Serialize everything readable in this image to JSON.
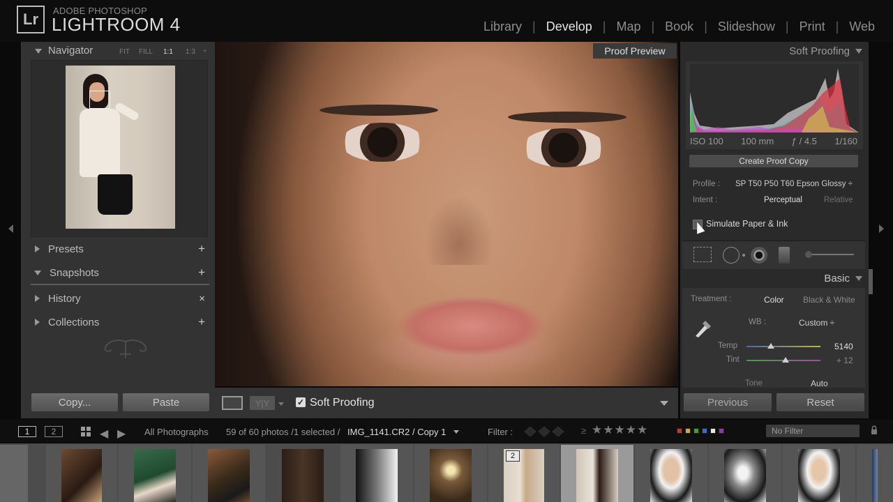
{
  "app": {
    "logo": "Lr",
    "brand_line1": "ADOBE PHOTOSHOP",
    "brand_line2": "LIGHTROOM 4"
  },
  "modules": [
    {
      "label": "Library",
      "active": false
    },
    {
      "label": "Develop",
      "active": true
    },
    {
      "label": "Map",
      "active": false
    },
    {
      "label": "Book",
      "active": false
    },
    {
      "label": "Slideshow",
      "active": false
    },
    {
      "label": "Print",
      "active": false
    },
    {
      "label": "Web",
      "active": false
    }
  ],
  "navigator": {
    "title": "Navigator",
    "zoom_options": [
      "FIT",
      "FILL",
      "1:1",
      "1:3"
    ],
    "active_zoom": "1:1"
  },
  "left_panels": [
    {
      "title": "Presets",
      "action": "+"
    },
    {
      "title": "Snapshots",
      "action": "+"
    },
    {
      "title": "History",
      "action": "×"
    },
    {
      "title": "Collections",
      "action": "+"
    }
  ],
  "left_buttons": {
    "copy": "Copy...",
    "paste": "Paste"
  },
  "center": {
    "proof_label": "Proof Preview"
  },
  "toolbar": {
    "view_compare": "Y|Y",
    "soft_proofing_label": "Soft Proofing",
    "soft_proofing_checked": true
  },
  "soft_proofing": {
    "title": "Soft Proofing",
    "histogram_meta": [
      "ISO 100",
      "100 mm",
      "ƒ / 4.5",
      "1/160"
    ],
    "create_proof_copy": "Create Proof Copy",
    "profile_label": "Profile :",
    "profile_value": "SP T50 P50 T60 Epson Glossy ÷",
    "intent_label": "Intent :",
    "intent_options": [
      "Perceptual",
      "Relative"
    ],
    "intent_selected": "Perceptual",
    "simulate_label": "Simulate Paper & Ink",
    "simulate_checked": false
  },
  "basic": {
    "title": "Basic",
    "treatment_label": "Treatment :",
    "treatment_color": "Color",
    "treatment_bw": "Black & White",
    "wb_label": "WB :",
    "wb_value": "Custom ÷",
    "temp_label": "Temp",
    "temp_value": "5140",
    "tint_label": "Tint",
    "tint_value": "+ 12",
    "tone_label": "Tone",
    "auto_label": "Auto"
  },
  "right_buttons": {
    "previous": "Previous",
    "reset": "Reset"
  },
  "filmstrip_bar": {
    "view1": "1",
    "view2": "2",
    "source": "All Photographs",
    "count": "59 of 60 photos /1 selected /",
    "filename": "IMG_1141.CR2 / Copy 1",
    "filter_label": "Filter :",
    "rating_compare": "≥",
    "stars": "★★★★★",
    "filter_value": "No Filter",
    "color_labels": [
      "#c0392b",
      "#c9b037",
      "#4a9a3a",
      "#3b6cc4",
      "#e8e8e8",
      "#8a3aa0"
    ]
  },
  "filmstrip": {
    "badge": "2"
  }
}
